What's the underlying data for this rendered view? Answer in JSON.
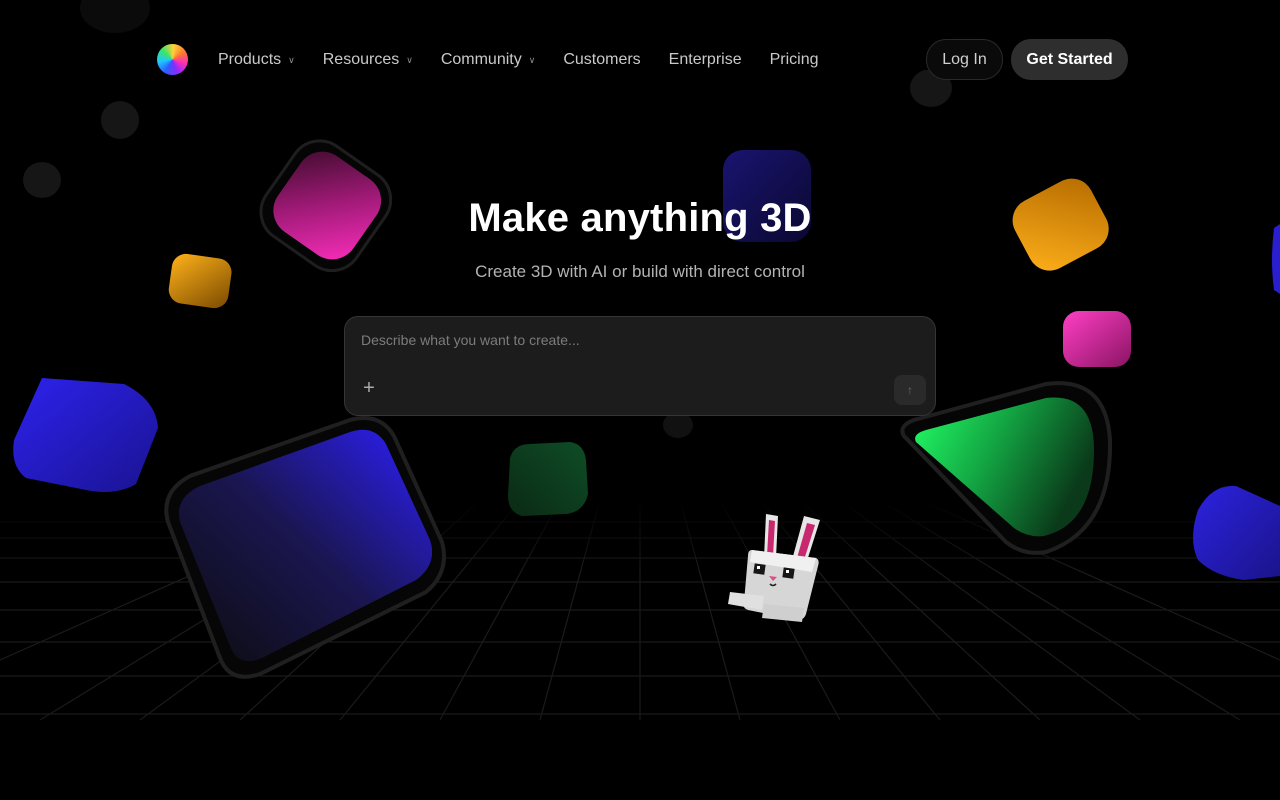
{
  "nav": {
    "logo_name": "app-logo",
    "items": [
      {
        "label": "Products",
        "has_dropdown": true
      },
      {
        "label": "Resources",
        "has_dropdown": true
      },
      {
        "label": "Community",
        "has_dropdown": true
      },
      {
        "label": "Customers",
        "has_dropdown": false
      },
      {
        "label": "Enterprise",
        "has_dropdown": false
      },
      {
        "label": "Pricing",
        "has_dropdown": false
      }
    ],
    "login_label": "Log In",
    "get_started_label": "Get Started"
  },
  "hero": {
    "title": "Make anything 3D",
    "subtitle": "Create 3D with AI or build with direct control"
  },
  "prompt": {
    "placeholder": "Describe what you want to create...",
    "value": "",
    "add_icon": "plus-icon",
    "send_icon": "arrow-up-icon"
  },
  "colors": {
    "background": "#000000",
    "magenta": "#ff2fb6",
    "orange": "#ffa514",
    "blue": "#2a1cff",
    "green": "#1ee85a",
    "button_dark": "#2e2e2e",
    "input_bg": "#1c1c1c"
  }
}
